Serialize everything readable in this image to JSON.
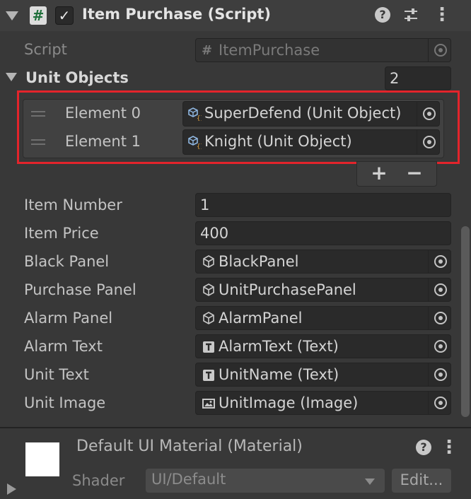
{
  "header": {
    "title": "Item Purchase (Script)",
    "script_icon_glyph": "#",
    "enabled_check_glyph": "✓",
    "help_glyph": "?",
    "kebab_glyph": "⋮",
    "icons": [
      "foldout-arrow-icon",
      "script-icon",
      "enabled-checkbox",
      "help-icon",
      "preset-icon",
      "kebab-menu-icon"
    ]
  },
  "script_row": {
    "label": "Script",
    "value": "ItemPurchase",
    "icon_glyph": "#"
  },
  "unit_objects": {
    "label": "Unit Objects",
    "size": "2",
    "elements": [
      {
        "label": "Element 0",
        "value": "SuperDefend (Unit Object)"
      },
      {
        "label": "Element 1",
        "value": "Knight (Unit Object)"
      }
    ],
    "add_glyph": "+",
    "remove_glyph": "−",
    "highlight_color": "#e3242b"
  },
  "fields": {
    "item_number": {
      "label": "Item Number",
      "value": "1"
    },
    "item_price": {
      "label": "Item Price",
      "value": "400"
    },
    "black_panel": {
      "label": "Black Panel",
      "value": "BlackPanel",
      "icon": "gameobject-icon"
    },
    "purchase_panel": {
      "label": "Purchase Panel",
      "value": "UnitPurchasePanel",
      "icon": "gameobject-icon"
    },
    "alarm_panel": {
      "label": "Alarm Panel",
      "value": "AlarmPanel",
      "icon": "gameobject-icon"
    },
    "alarm_text": {
      "label": "Alarm Text",
      "value": "AlarmText (Text)",
      "icon": "text-icon"
    },
    "unit_text": {
      "label": "Unit Text",
      "value": "UnitName (Text)",
      "icon": "text-icon"
    },
    "unit_image": {
      "label": "Unit Image",
      "value": "UnitImage (Image)",
      "icon": "image-icon"
    }
  },
  "material": {
    "title": "Default UI Material (Material)",
    "shader_label": "Shader",
    "shader_value": "UI/Default",
    "edit_label": "Edit...",
    "help_glyph": "?",
    "kebab_glyph": "⋮"
  },
  "colors": {
    "background": "#383838",
    "field": "#2a2a2a",
    "accent_highlight": "#e3242b"
  }
}
